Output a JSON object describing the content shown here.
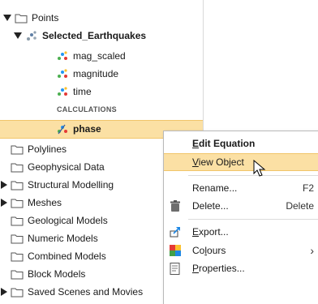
{
  "tree": {
    "points": "Points",
    "selected": "Selected_Earthquakes",
    "children": [
      "mag_scaled",
      "magnitude",
      "time"
    ],
    "section": "CALCULATIONS",
    "phase": "phase",
    "folders": [
      "Polylines",
      "Geophysical Data",
      "Structural Modelling",
      "Meshes",
      "Geological Models",
      "Numeric Models",
      "Combined Models",
      "Block Models",
      "Saved Scenes and Movies"
    ]
  },
  "menu": {
    "edit_equation": {
      "pre": "",
      "u": "E",
      "post": "dit Equation"
    },
    "view_object": {
      "pre": "",
      "u": "V",
      "post": "iew Object"
    },
    "rename": "Rename...",
    "rename_shortcut": "F2",
    "delete": "Delete...",
    "delete_shortcut": "Delete",
    "export": {
      "pre": "",
      "u": "E",
      "post": "xport..."
    },
    "colours": {
      "pre": "Co",
      "u": "l",
      "post": "ours"
    },
    "properties": {
      "pre": "",
      "u": "P",
      "post": "roperties..."
    }
  },
  "colors": {
    "highlight": "#fbe0a4",
    "highlight_border": "#f1c56a"
  }
}
